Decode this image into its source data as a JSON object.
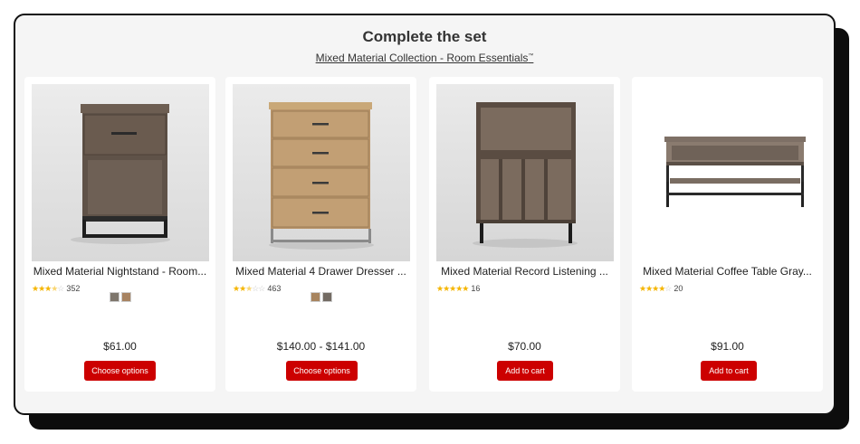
{
  "section": {
    "title": "Complete the set",
    "collection_link": "Mixed Material Collection - Room Essentials",
    "trademark": "™"
  },
  "products": [
    {
      "name": "Mixed Material Nightstand - Room...",
      "rating": 3.5,
      "stars_filled": "★★★",
      "stars_half": "★",
      "stars_empty": "☆",
      "review_count": "352",
      "swatch_colors": [
        "#7e766c",
        "#a78361"
      ],
      "price": "$61.00",
      "button_label": "Choose options"
    },
    {
      "name": "Mixed Material 4 Drawer Dresser ...",
      "rating": 2.5,
      "stars_filled": "★★",
      "stars_half": "★",
      "stars_empty": "☆☆",
      "review_count": "463",
      "swatch_colors": [
        "#a7845f",
        "#736b63"
      ],
      "price": "$140.00 - $141.00",
      "button_label": "Choose options"
    },
    {
      "name": "Mixed Material Record Listening ...",
      "rating": 5,
      "stars_filled": "★★★★★",
      "stars_half": "",
      "stars_empty": "",
      "review_count": "16",
      "swatch_colors": [],
      "price": "$70.00",
      "button_label": "Add to cart"
    },
    {
      "name": "Mixed Material Coffee Table Gray...",
      "rating": 4,
      "stars_filled": "★★★★",
      "stars_half": "",
      "stars_empty": "☆",
      "review_count": "20",
      "swatch_colors": [],
      "price": "$91.00",
      "button_label": "Add to cart"
    }
  ],
  "colors": {
    "accent_red": "#cc0000",
    "star_gold": "#f5b500",
    "panel_bg": "#f5f5f5"
  }
}
